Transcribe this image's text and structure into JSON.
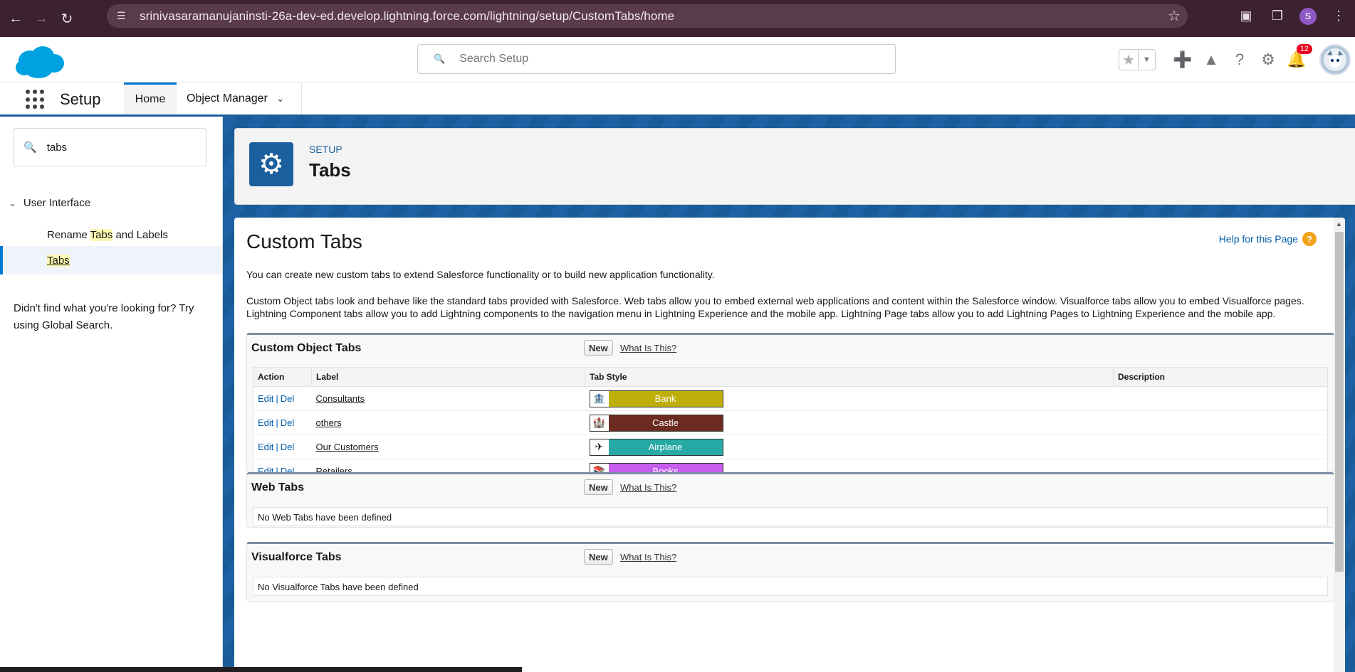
{
  "browser": {
    "url": "srinivasaramanujaninsti-26a-dev-ed.develop.lightning.force.com/lightning/setup/CustomTabs/home",
    "profile_initial": "S"
  },
  "header": {
    "search_placeholder": "Search Setup",
    "notification_count": "12"
  },
  "context_bar": {
    "app_name": "Setup",
    "tabs": [
      {
        "label": "Home"
      },
      {
        "label": "Object Manager"
      }
    ]
  },
  "left_nav": {
    "quick_find_value": "tabs",
    "section_label": "User Interface",
    "items": [
      {
        "label_pre": "Rename ",
        "label_hl": "Tabs",
        "label_post": " and Labels"
      },
      {
        "label_hl": "Tabs"
      }
    ],
    "help_text": "Didn't find what you're looking for? Try using Global Search."
  },
  "page_header": {
    "breadcrumb": "SETUP",
    "title": "Tabs"
  },
  "content": {
    "title": "Custom Tabs",
    "help_link": "Help for this Page",
    "intro": "You can create new custom tabs to extend Salesforce functionality or to build new application functionality.",
    "intro2": "Custom Object tabs look and behave like the standard tabs provided with Salesforce. Web tabs allow you to embed external web applications and content within the Salesforce window. Visualforce tabs allow you to embed Visualforce pages. Lightning Component tabs allow you to add Lightning components to the navigation menu in Lightning Experience and the mobile app. Lightning Page tabs allow you to add Lightning Pages to Lightning Experience and the mobile app.",
    "new_label": "New",
    "what_label": "What Is This?",
    "custom_object_tabs": {
      "heading": "Custom Object Tabs",
      "columns": [
        "Action",
        "Label",
        "Tab Style",
        "Description"
      ],
      "edit": "Edit",
      "del": "Del",
      "rows": [
        {
          "label": "Consultants",
          "style": "Bank",
          "color": "#bfae0a",
          "icon": "bank-icon",
          "glyph": "🏦"
        },
        {
          "label": "others",
          "style": "Castle",
          "color": "#6b2b20",
          "icon": "castle-icon",
          "glyph": "🏰"
        },
        {
          "label": "Our Customers",
          "style": "Airplane",
          "color": "#27a9a5",
          "icon": "airplane-icon",
          "glyph": "✈"
        },
        {
          "label": "Retailers",
          "style": "Books",
          "color": "#c65ded",
          "icon": "books-icon",
          "glyph": "📚"
        }
      ]
    },
    "web_tabs": {
      "heading": "Web Tabs",
      "empty": "No Web Tabs have been defined"
    },
    "visualforce_tabs": {
      "heading": "Visualforce Tabs",
      "empty": "No Visualforce Tabs have been defined"
    }
  }
}
